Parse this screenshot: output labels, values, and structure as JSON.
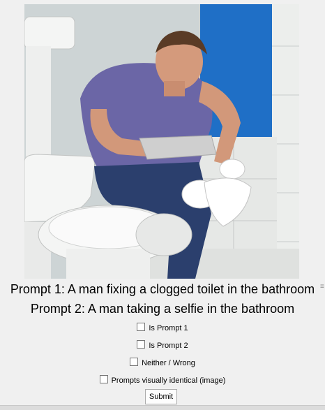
{
  "image": {
    "subject": "man-kneeling-by-toilet-photo"
  },
  "prompts": {
    "prompt1": "Prompt 1: A man fixing a clogged toilet in the bathroom",
    "prompt2": "Prompt 2: A man taking a selfie in the bathroom"
  },
  "options": [
    {
      "label": "Is Prompt 1",
      "checked": false
    },
    {
      "label": "Is Prompt 2",
      "checked": false
    },
    {
      "label": "Neither / Wrong",
      "checked": false
    },
    {
      "label": "Prompts visually identical (image)",
      "checked": false
    }
  ],
  "submit_label": "Submit",
  "colors": {
    "window_bg": "#f0f0f0",
    "tile_wall": "#e9ecea",
    "blue_wall": "#1e6fc8",
    "shirt": "#6e68a8",
    "jeans": "#2a3f6e"
  },
  "icons": {
    "resize_grip": "resize-grip-icon"
  }
}
